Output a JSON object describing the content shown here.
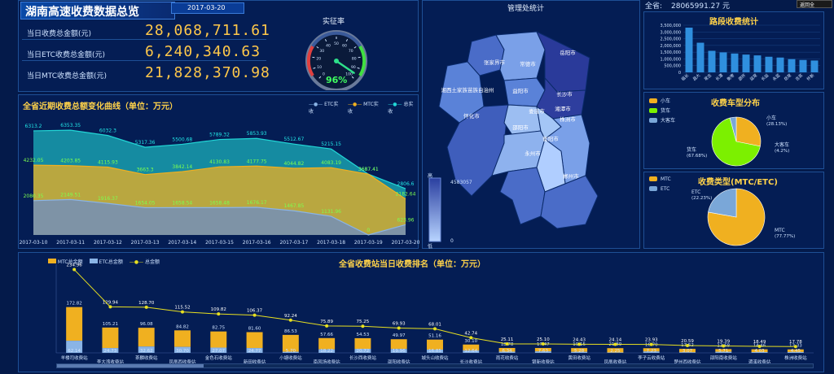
{
  "header": {
    "title": "湖南高速收费数据总览",
    "date": "2017-03-20",
    "back_label": "返回全"
  },
  "summary": {
    "items": [
      {
        "label": "当日收费总金额(元)",
        "value": "28,068,711.61"
      },
      {
        "label": "当日ETC收费总金额(元)",
        "value": "6,240,340.63"
      },
      {
        "label": "当日MTC收费总金额(元)",
        "value": "21,828,370.98"
      }
    ],
    "gauge_title": "实征率",
    "gauge_value": "96%",
    "gauge_fraction": 0.96,
    "gauge_ticks": [
      "0",
      "10",
      "20",
      "30",
      "40",
      "50",
      "60",
      "70",
      "80",
      "90",
      "100"
    ]
  },
  "trend": {
    "title": "全省近期收费总额变化曲线（单位：万元）",
    "legend": [
      "ETC实收",
      "MTC实收",
      "总实收"
    ],
    "dates": [
      "2017-03-10",
      "2017-03-11",
      "2017-03-12",
      "2017-03-13",
      "2017-03-14",
      "2017-03-15",
      "2017-03-16",
      "2017-03-17",
      "2017-03-18",
      "2017-03-19",
      "2017-03-20"
    ],
    "total": [
      6313.2,
      6353.35,
      6032.3,
      5317.36,
      5500.68,
      5789.32,
      5853.93,
      5512.67,
      5215.15,
      3687.41,
      2806.6
    ],
    "total_labels": [
      "6313.2",
      "6353.35",
      "6032.3",
      "5317.36",
      "5500.68",
      "5789.32",
      "5853.93",
      "5512.67",
      "5215.15",
      "3687.41",
      "2806.6"
    ],
    "mtc": [
      4232.05,
      4203.85,
      4115.93,
      3663.3,
      3842.14,
      4130.83,
      4177.75,
      4044.82,
      4083.19,
      3687.41,
      2182.64
    ],
    "mtc_labels": [
      "4232.05",
      "4203.85",
      "4115.93",
      "3663.3",
      "3842.14",
      "4130.83",
      "4177.75",
      "4044.82",
      "4083.19",
      "3687.41",
      "2182.64"
    ],
    "etc": [
      2080.35,
      2149.51,
      1916.37,
      1654.05,
      1658.54,
      1658.48,
      1676.17,
      1467.85,
      1131.96,
      0,
      623.96
    ],
    "etc_labels": [
      "2080.35",
      "2149.51",
      "1916.37",
      "1654.05",
      "1658.54",
      "1658.48",
      "1676.17",
      "1467.85",
      "1131.96",
      "0",
      "623.96"
    ],
    "colors": {
      "etc": "#8ab4e6",
      "mtc": "#f0b020",
      "total": "#22d6d6"
    }
  },
  "map": {
    "title": "管理处统计",
    "scale_high": "高",
    "scale_low": "低",
    "scale_max": "4583057",
    "scale_min": "0",
    "cities": [
      "张家界市",
      "常德市",
      "岳阳市",
      "湘西土家族苗族自治州",
      "益阳市",
      "长沙市",
      "怀化市",
      "娄底市",
      "湘潭市",
      "株洲市",
      "邵阳市",
      "衡阳市",
      "永州市",
      "郴州市"
    ]
  },
  "province": {
    "label": "全省:",
    "value": "28065991.27 元"
  },
  "road": {
    "title": "路段收费统计",
    "yticks": [
      "3,500,000",
      "3,000,000",
      "2,500,000",
      "2,000,000",
      "1,500,000",
      "1,000,000",
      "500,000",
      "0"
    ],
    "categories": [
      "临长",
      "昌大",
      "常吉",
      "长潭",
      "衡枣",
      "邵怀",
      "益常",
      "长益",
      "永蓝",
      "岳常",
      "吉茶",
      "怀新"
    ],
    "values": [
      3320000,
      2200000,
      1600000,
      1480000,
      1400000,
      1320000,
      1260000,
      1160000,
      1100000,
      980000,
      920000,
      880000
    ],
    "color": "#2f8fde"
  },
  "vehicle": {
    "title": "收费车型分布",
    "legend": [
      "小车",
      "货车",
      "大客车"
    ],
    "slices": [
      {
        "name": "小车",
        "pct": "(28.13%)",
        "value": 28.13,
        "color": "#f0b020"
      },
      {
        "name": "货车",
        "pct": "(67.68%)",
        "value": 67.68,
        "color": "#7cf000"
      },
      {
        "name": "大客车",
        "pct": "(4.2%)",
        "value": 4.2,
        "color": "#7aa7d8"
      }
    ]
  },
  "paytype": {
    "title": "收费类型(MTC/ETC)",
    "legend": [
      "MTC",
      "ETC"
    ],
    "slices": [
      {
        "name": "MTC",
        "pct": "(77.77%)",
        "value": 77.77,
        "color": "#f0b020"
      },
      {
        "name": "ETC",
        "pct": "(22.23%)",
        "value": 22.23,
        "color": "#7aa7d8"
      }
    ]
  },
  "ranking": {
    "title": "全省收费站当日收费排名（单位：万元）",
    "legend": [
      "MTC总金额",
      "ETC总金额",
      "总金额"
    ],
    "stations": [
      "羊楼司收费站",
      "李大湾收费站",
      "茶麟收费站",
      "凤凰西收费站",
      "金色石收费站",
      "新田收费站",
      "小塘收费站",
      "南风场收费站",
      "长沙西收费站",
      "邵阳收费站",
      "城头山收费站",
      "长沙收费站",
      "雨花收费站",
      "银新收费站",
      "黄田收费站",
      "凤凰收费站",
      "李子云收费站",
      "楚州西收费站",
      "邵阳南收费站",
      "湄溪收费站",
      "株洲收费站"
    ],
    "total": [
      234.96,
      129.94,
      128.7,
      115.52,
      109.82,
      106.37,
      92.24,
      75.89,
      75.25,
      69.93,
      68.01,
      42.74,
      25.11,
      25.1,
      24.43,
      24.14,
      23.93,
      20.59,
      19.39,
      18.49,
      17.78
    ],
    "total_labels": [
      "234.96",
      "129.94",
      "128.70",
      "115.52",
      "109.82",
      "106.37",
      "92.24",
      "75.89",
      "75.25",
      "69.93",
      "68.01",
      "42.74",
      "25.11",
      "25.10",
      "24.43",
      "24.14",
      "23.93",
      "20.59",
      "19.39",
      "18.49",
      "17.78"
    ],
    "mtc": [
      172.82,
      105.21,
      96.08,
      84.82,
      82.75,
      81.6,
      86.53,
      57.66,
      54.53,
      49.97,
      51.16,
      30.1,
      18.78,
      17.47,
      19.15,
      21.89,
      16.7,
      17.52,
      13.68,
      14.46,
      13.33
    ],
    "mtc_labels": [
      "172.82",
      "105.21",
      "96.08",
      "84.82",
      "82.75",
      "81.60",
      "86.53",
      "57.66",
      "54.53",
      "49.97",
      "51.16",
      "30.10",
      "18.78",
      "17.47",
      "19.15",
      "21.89",
      "16.70",
      "17.52",
      "13.68",
      "14.46",
      "13.33"
    ],
    "etc": [
      62.14,
      24.73,
      32.62,
      30.7,
      27.07,
      24.77,
      5.7,
      18.22,
      20.72,
      19.96,
      16.85,
      12.64,
      6.34,
      7.63,
      5.28,
      2.25,
      7.23,
      3.07,
      5.71,
      4.03,
      4.45
    ],
    "etc_labels": [
      "62.14",
      "24.73",
      "32.62",
      "30.70",
      "27.07",
      "24.77",
      "5.70",
      "18.22",
      "20.72",
      "19.96",
      "16.85",
      "12.64",
      "6.34",
      "7.63",
      "5.28",
      "2.25",
      "7.23",
      "3.07",
      "5.71",
      "4.03",
      "4.45"
    ],
    "colors": {
      "mtc": "#f0b020",
      "etc": "#8ab4e6",
      "total": "#e8e020"
    }
  }
}
